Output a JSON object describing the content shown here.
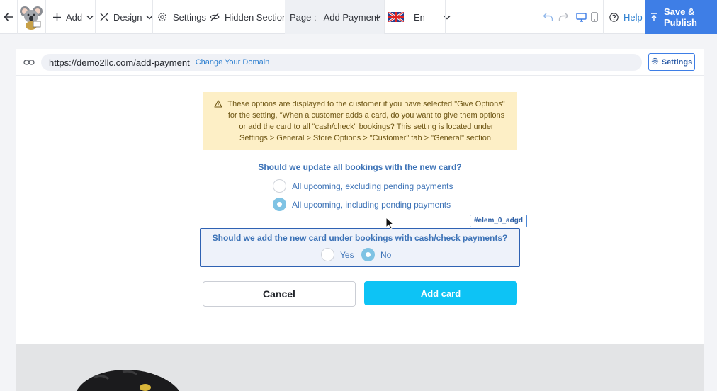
{
  "toolbar": {
    "add_label": "Add",
    "design_label": "Design",
    "settings_label": "Settings",
    "hidden_sections_label": "Hidden Sections",
    "page_prefix": "Page :",
    "page_name": "Add Payment",
    "language": "En",
    "help_label": "Help",
    "publish_label": "Save & Publish"
  },
  "urlbar": {
    "url": "https://demo2llc.com/add-payment",
    "change_domain": "Change Your Domain",
    "settings_label": "Settings"
  },
  "notice": {
    "text": "These options are displayed to the customer if you have selected \"Give Options\" for the setting, \"When a customer adds a card, do you want to give them options or add the card to all \"cash/check\" bookings? This setting is located under Settings > General > Store Options > \"Customer\" tab > \"General\" section."
  },
  "question1": {
    "label": "Should we update all bookings with the new card?",
    "options": [
      {
        "label": "All upcoming, excluding pending payments",
        "selected": false
      },
      {
        "label": "All upcoming, including pending payments",
        "selected": true
      }
    ]
  },
  "selected_element_id": "#elem_0_adgd",
  "question2": {
    "label": "Should we add the new card under bookings with cash/check payments?",
    "options": [
      {
        "label": "Yes",
        "selected": false
      },
      {
        "label": "No",
        "selected": true
      }
    ]
  },
  "buttons": {
    "cancel": "Cancel",
    "add_card": "Add card"
  },
  "colors": {
    "accent": "#3e7ee6",
    "primary_button": "#0dc3f5",
    "notice_bg": "#fdefc6",
    "question_text": "#3d73b7"
  },
  "icons": [
    "back-arrow-icon",
    "koala-logo",
    "plus-icon",
    "design-tools-icon",
    "gear-icon",
    "eye-slash-icon",
    "uk-flag-icon",
    "undo-icon",
    "redo-icon",
    "desktop-icon",
    "mobile-icon",
    "help-icon",
    "upload-icon",
    "link-icon",
    "warning-icon",
    "mouse-cursor-icon"
  ]
}
